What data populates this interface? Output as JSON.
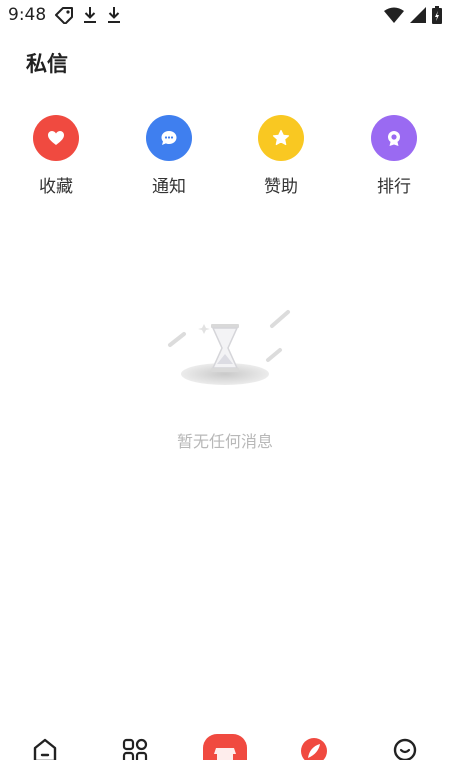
{
  "status_bar": {
    "time": "9:48",
    "left_icons": [
      "tag-icon",
      "download-icon",
      "download-icon"
    ],
    "right_icons": [
      "wifi-icon",
      "signal-icon",
      "battery-icon"
    ]
  },
  "header": {
    "title": "私信"
  },
  "quick_actions": [
    {
      "label": "收藏",
      "icon": "heart-icon",
      "color": "#F04A40"
    },
    {
      "label": "通知",
      "icon": "chat-bubble-icon",
      "color": "#3F7FEF"
    },
    {
      "label": "赞助",
      "icon": "star-icon",
      "color": "#F9C822"
    },
    {
      "label": "排行",
      "icon": "trophy-icon",
      "color": "#9A6AF2"
    }
  ],
  "empty_state": {
    "icon": "hourglass-icon",
    "text": "暂无任何消息"
  },
  "tab_bar": {
    "tabs": [
      {
        "icon": "home-icon"
      },
      {
        "icon": "grid-icon"
      },
      {
        "icon": "shop-icon",
        "color": "#F04A40"
      },
      {
        "icon": "feather-icon",
        "color": "#F04A40"
      },
      {
        "icon": "profile-icon"
      }
    ]
  }
}
